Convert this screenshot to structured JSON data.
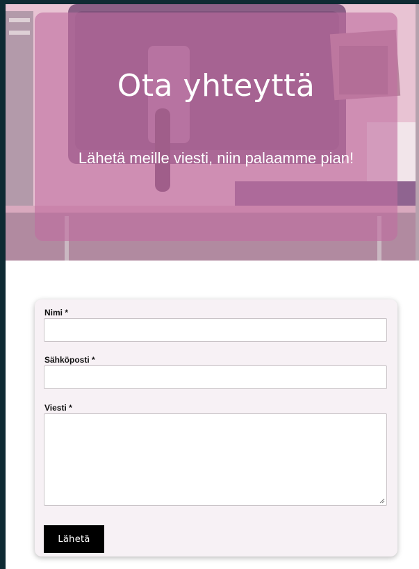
{
  "hero": {
    "title": "Ota yhteyttä",
    "subtitle": "Lähetä meille viesti, niin palaamme pian!"
  },
  "form": {
    "fields": [
      {
        "label": "Nimi",
        "required_mark": "*",
        "value": ""
      },
      {
        "label": "Sähköposti",
        "required_mark": "*",
        "value": ""
      },
      {
        "label": "Viesti",
        "required_mark": "*",
        "value": ""
      }
    ],
    "submit_label": "Lähetä"
  },
  "colors": {
    "overlay": "#c06ea0",
    "button": "#000000",
    "card": "#f7f1f5",
    "edge": "#0e2a33"
  }
}
